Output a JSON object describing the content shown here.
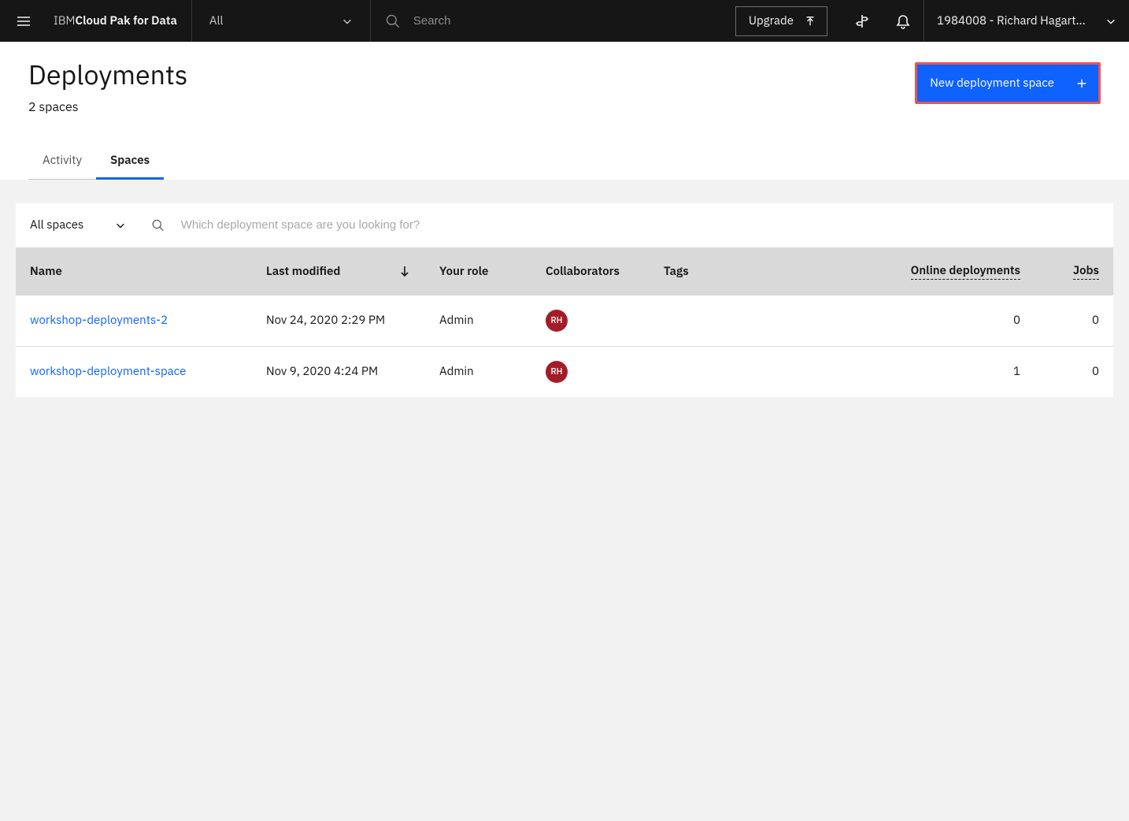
{
  "topbar": {
    "brand_thin": "IBM ",
    "brand_bold": "Cloud Pak for Data",
    "scope_label": "All",
    "search_placeholder": "Search",
    "upgrade_label": "Upgrade",
    "user_label": "1984008 - Richard Hagart..."
  },
  "page": {
    "title": "Deployments",
    "subtitle": "2 spaces",
    "new_button": "New deployment space"
  },
  "tabs": [
    {
      "label": "Activity",
      "active": false
    },
    {
      "label": "Spaces",
      "active": true
    }
  ],
  "toolbar": {
    "filter_label": "All spaces",
    "search_placeholder": "Which deployment space are you looking for?"
  },
  "columns": {
    "name": "Name",
    "last_modified": "Last modified",
    "role": "Your role",
    "collaborators": "Collaborators",
    "tags": "Tags",
    "online": "Online deployments",
    "jobs": "Jobs"
  },
  "rows": [
    {
      "name": "workshop-deployments-2",
      "last_modified": "Nov 24, 2020 2:29 PM",
      "role": "Admin",
      "collab_initials": "RH",
      "tags": "",
      "online": "0",
      "jobs": "0"
    },
    {
      "name": "workshop-deployment-space",
      "last_modified": "Nov 9, 2020 4:24 PM",
      "role": "Admin",
      "collab_initials": "RH",
      "tags": "",
      "online": "1",
      "jobs": "0"
    }
  ]
}
